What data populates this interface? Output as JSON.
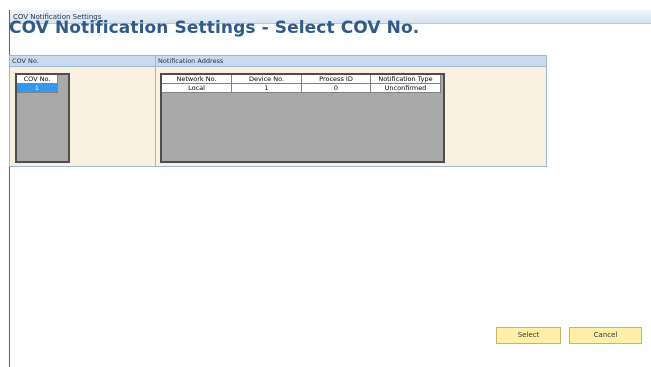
{
  "window": {
    "title": "COV Notification Settings"
  },
  "page": {
    "title": "COV Notification Settings - Select COV No."
  },
  "cov_panel": {
    "header": "COV No.",
    "column_header": "COV No.",
    "rows": [
      "1"
    ],
    "selected_row": 0
  },
  "notification_panel": {
    "header": "Notification Address",
    "columns": [
      "Network No.",
      "Device No.",
      "Process ID",
      "Notification Type"
    ],
    "rows": [
      [
        "Local",
        "1",
        "0",
        "Unconfirmed"
      ]
    ]
  },
  "buttons": {
    "select_label": "Select",
    "cancel_label": "Cancel"
  },
  "colors": {
    "title": "#2e5a8c",
    "panel_header": "#c9daee",
    "panel_background": "#faf0e0",
    "grid_background": "#a9a9a9",
    "selected_row": "#3399ee",
    "button": "#fff0a8"
  }
}
